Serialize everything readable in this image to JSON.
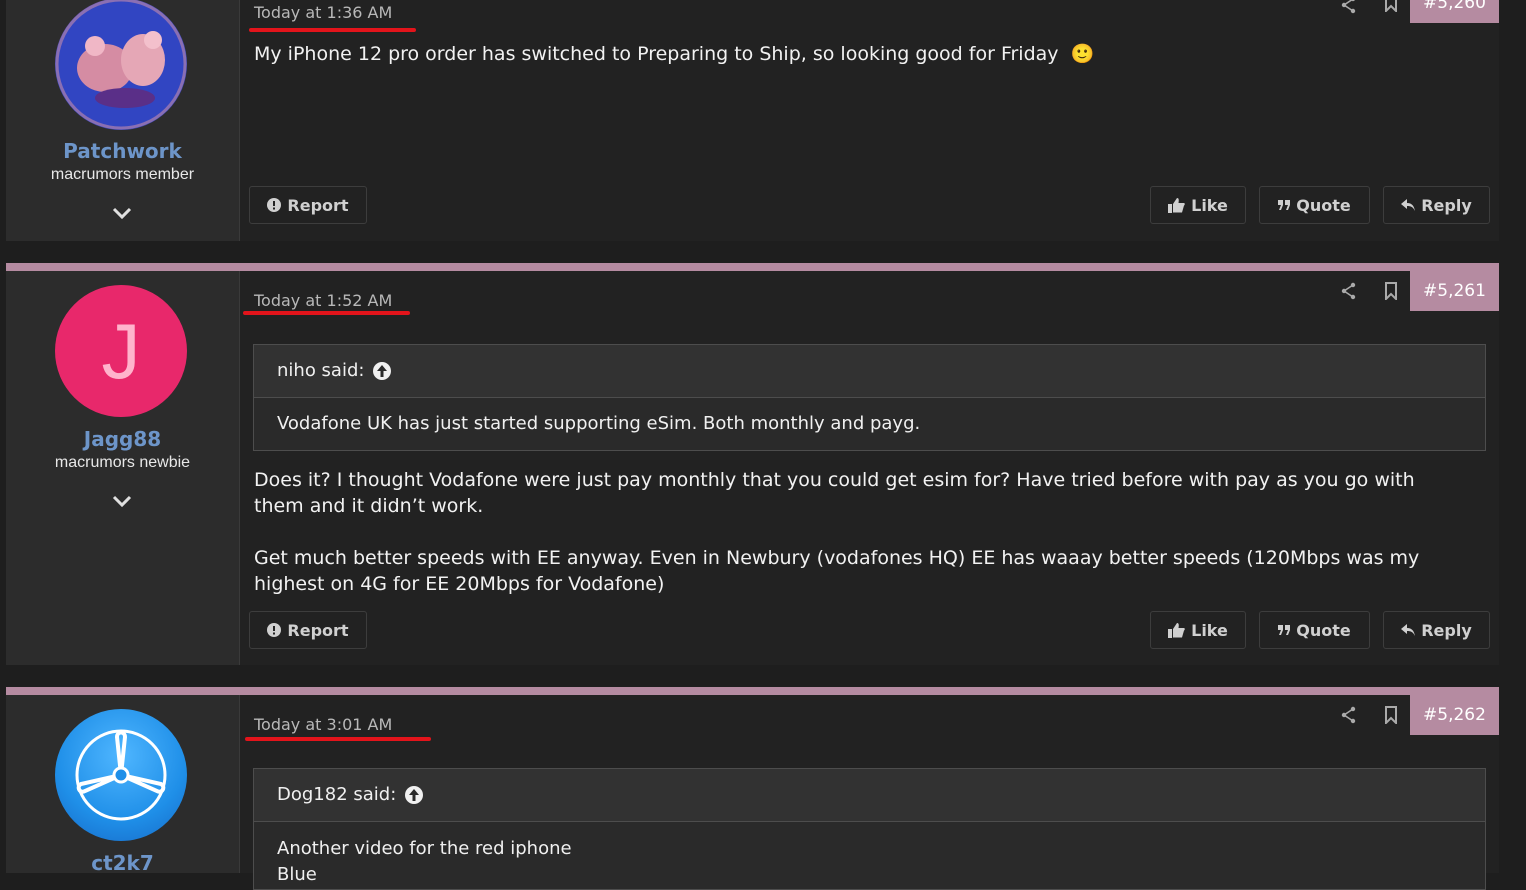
{
  "posts": [
    {
      "username": "Patchwork",
      "user_title": "macrumors member",
      "timestamp": "Today at 1:36 AM",
      "post_number": "#5,260",
      "message": "My iPhone 12 pro order has switched to Preparing to Ship, so looking good for Friday",
      "emoji": "🙂"
    },
    {
      "username": "Jagg88",
      "user_title": "macrumors newbie",
      "avatar_letter": "J",
      "timestamp": "Today at 1:52 AM",
      "post_number": "#5,261",
      "quote_author": "niho said:",
      "quote_text": "Vodafone UK has just started supporting eSim. Both monthly and payg.",
      "paragraph1": "Does it? I thought Vodafone were just pay monthly that you could get esim for? Have tried before with pay as you go with them and it didn’t work.",
      "paragraph2": "Get much better speeds with EE anyway. Even in Newbury (vodafones HQ) EE has waaay better speeds (120Mbps was my highest on 4G for EE 20Mbps for Vodafone)"
    },
    {
      "username": "ct2k7",
      "timestamp": "Today at 3:01 AM",
      "post_number": "#5,262",
      "quote_author": "Dog182 said:",
      "quote_text": "Another video for the red iphone",
      "quote_text2": "Blue"
    }
  ],
  "actions": {
    "report": "Report",
    "like": "Like",
    "quote": "Quote",
    "reply": "Reply"
  },
  "colors": {
    "accent_bar": "#b58ba1",
    "username": "#6d95c9",
    "underline": "#e3141b",
    "avatar_j": "#e8286b",
    "avatar_ct": "#1f8fe8"
  }
}
